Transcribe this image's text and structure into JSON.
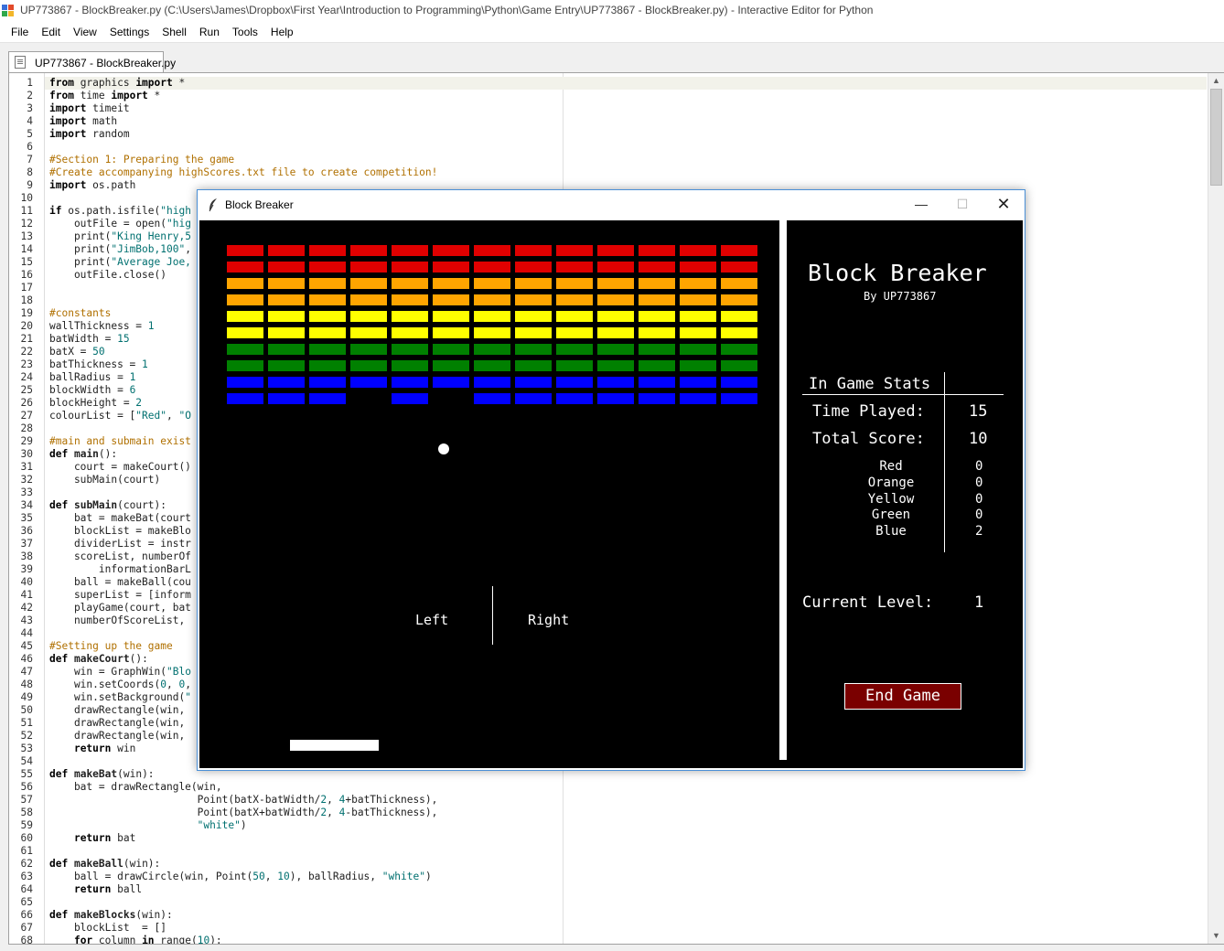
{
  "window": {
    "title": "UP773867 - BlockBreaker.py (C:\\Users\\James\\Dropbox\\First Year\\Introduction to Programming\\Python\\Game Entry\\UP773867 - BlockBreaker.py) - Interactive Editor for Python"
  },
  "menu": [
    "File",
    "Edit",
    "View",
    "Settings",
    "Shell",
    "Run",
    "Tools",
    "Help"
  ],
  "tab": {
    "label": "UP773867 - BlockBreaker.py"
  },
  "code_lines": [
    "from graphics import *",
    "from time import *",
    "import timeit",
    "import math",
    "import random",
    "",
    "#Section 1: Preparing the game",
    "#Create accompanying highScores.txt file to create competition!",
    "import os.path",
    "",
    "if os.path.isfile(\"high",
    "    outFile = open(\"hig",
    "    print(\"King Henry,5",
    "    print(\"JimBob,100\",",
    "    print(\"Average Joe,",
    "    outFile.close()",
    "",
    "",
    "#constants",
    "wallThickness = 1",
    "batWidth = 15",
    "batX = 50",
    "batThickness = 1",
    "ballRadius = 1",
    "blockWidth = 6",
    "blockHeight = 2",
    "colourList = [\"Red\", \"O",
    "",
    "#main and submain exist",
    "def main():",
    "    court = makeCourt()",
    "    subMain(court)",
    "",
    "def subMain(court):",
    "    bat = makeBat(court",
    "    blockList = makeBlo",
    "    dividerList = instr",
    "    scoreList, numberOf",
    "        informationBarL",
    "    ball = makeBall(cou",
    "    superList = [inform",
    "    playGame(court, bat",
    "    numberOfScoreList,",
    "",
    "#Setting up the game",
    "def makeCourt():",
    "    win = GraphWin(\"Blo",
    "    win.setCoords(0, 0,",
    "    win.setBackground(\"",
    "    drawRectangle(win,",
    "    drawRectangle(win,",
    "    drawRectangle(win,",
    "    return win",
    "",
    "def makeBat(win):",
    "    bat = drawRectangle(win,",
    "                        Point(batX-batWidth/2, 4+batThickness),",
    "                        Point(batX+batWidth/2, 4-batThickness),",
    "                        \"white\")",
    "    return bat",
    "",
    "def makeBall(win):",
    "    ball = drawCircle(win, Point(50, 10), ballRadius, \"white\")",
    "    return ball",
    "",
    "def makeBlocks(win):",
    "    blockList  = []",
    "    for column in range(10):"
  ],
  "game": {
    "window_title": "Block Breaker",
    "row_colors": [
      "#e00000",
      "#e00000",
      "#ffa500",
      "#ffa500",
      "#ffff00",
      "#ffff00",
      "#008000",
      "#008000",
      "#0000ff",
      "#0000ff"
    ],
    "blocks": [
      [
        1,
        1,
        1,
        1,
        1,
        1,
        1,
        1,
        1,
        1,
        1,
        1,
        1
      ],
      [
        1,
        1,
        1,
        1,
        1,
        1,
        1,
        1,
        1,
        1,
        1,
        1,
        1
      ],
      [
        1,
        1,
        1,
        1,
        1,
        1,
        1,
        1,
        1,
        1,
        1,
        1,
        1
      ],
      [
        1,
        1,
        1,
        1,
        1,
        1,
        1,
        1,
        1,
        1,
        1,
        1,
        1
      ],
      [
        1,
        1,
        1,
        1,
        1,
        1,
        1,
        1,
        1,
        1,
        1,
        1,
        1
      ],
      [
        1,
        1,
        1,
        1,
        1,
        1,
        1,
        1,
        1,
        1,
        1,
        1,
        1
      ],
      [
        1,
        1,
        1,
        1,
        1,
        1,
        1,
        1,
        1,
        1,
        1,
        1,
        1
      ],
      [
        1,
        1,
        1,
        1,
        1,
        1,
        1,
        1,
        1,
        1,
        1,
        1,
        1
      ],
      [
        1,
        1,
        1,
        1,
        1,
        1,
        1,
        1,
        1,
        1,
        1,
        1,
        1
      ],
      [
        1,
        1,
        1,
        0,
        1,
        0,
        1,
        1,
        1,
        1,
        1,
        1,
        1
      ]
    ],
    "left_label": "Left",
    "right_label": "Right",
    "title": "Block Breaker",
    "byline": "By UP773867",
    "stats_header": "In Game Stats",
    "time_label": "Time Played:",
    "time_value": "15",
    "score_label": "Total Score:",
    "score_value": "10",
    "colors": [
      "Red",
      "Orange",
      "Yellow",
      "Green",
      "Blue"
    ],
    "color_scores": [
      "0",
      "0",
      "0",
      "0",
      "2"
    ],
    "level_label": "Current Level:",
    "level_value": "1",
    "end_button": "End Game"
  }
}
